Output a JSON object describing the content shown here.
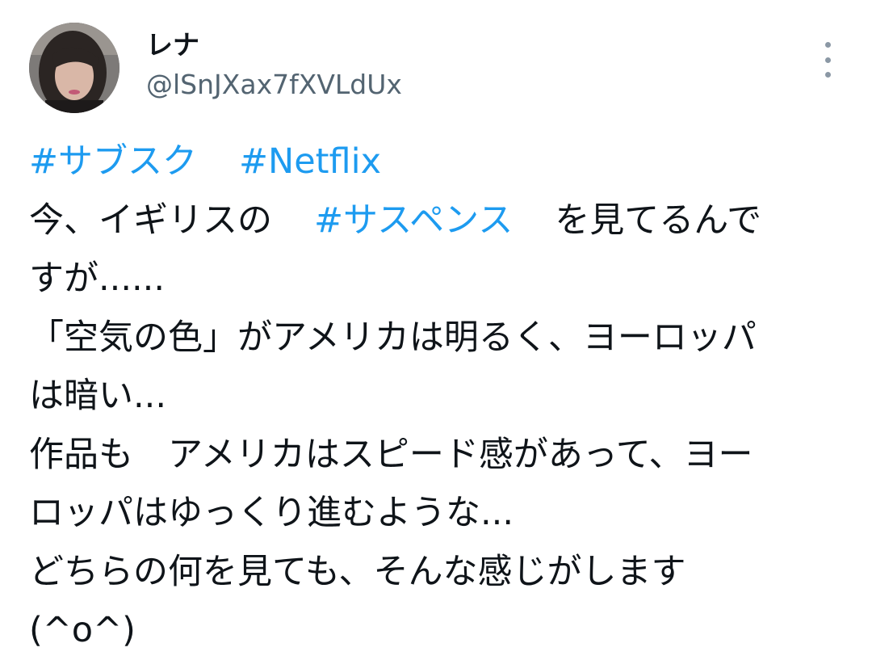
{
  "user": {
    "display_name": "レナ",
    "handle": "@lSnJXax7fXVLdUx"
  },
  "menu": {
    "icon": "more-vertical-icon"
  },
  "tweet": {
    "hashtags_line": {
      "tag1": "#サブスク",
      "tag2": "#Netflix"
    },
    "line2": {
      "before": "今、イギリスの",
      "tag": "#サスペンス",
      "after": "を見てるんで"
    },
    "line3": "すが......",
    "line4": "「空気の色」がアメリカは明るく、ヨーロッパ",
    "line5": "は暗い...",
    "line6": "作品も　アメリカはスピード感があって、ヨー",
    "line7": "ロッパはゆっくり進むような...",
    "line8": "どちらの何を見ても、そんな感じがします",
    "line9": "(^o^)"
  },
  "colors": {
    "hashtag": "#1d9bf0",
    "text": "#0f1419",
    "handle": "#536471",
    "menu_dots": "#8b98a5"
  }
}
